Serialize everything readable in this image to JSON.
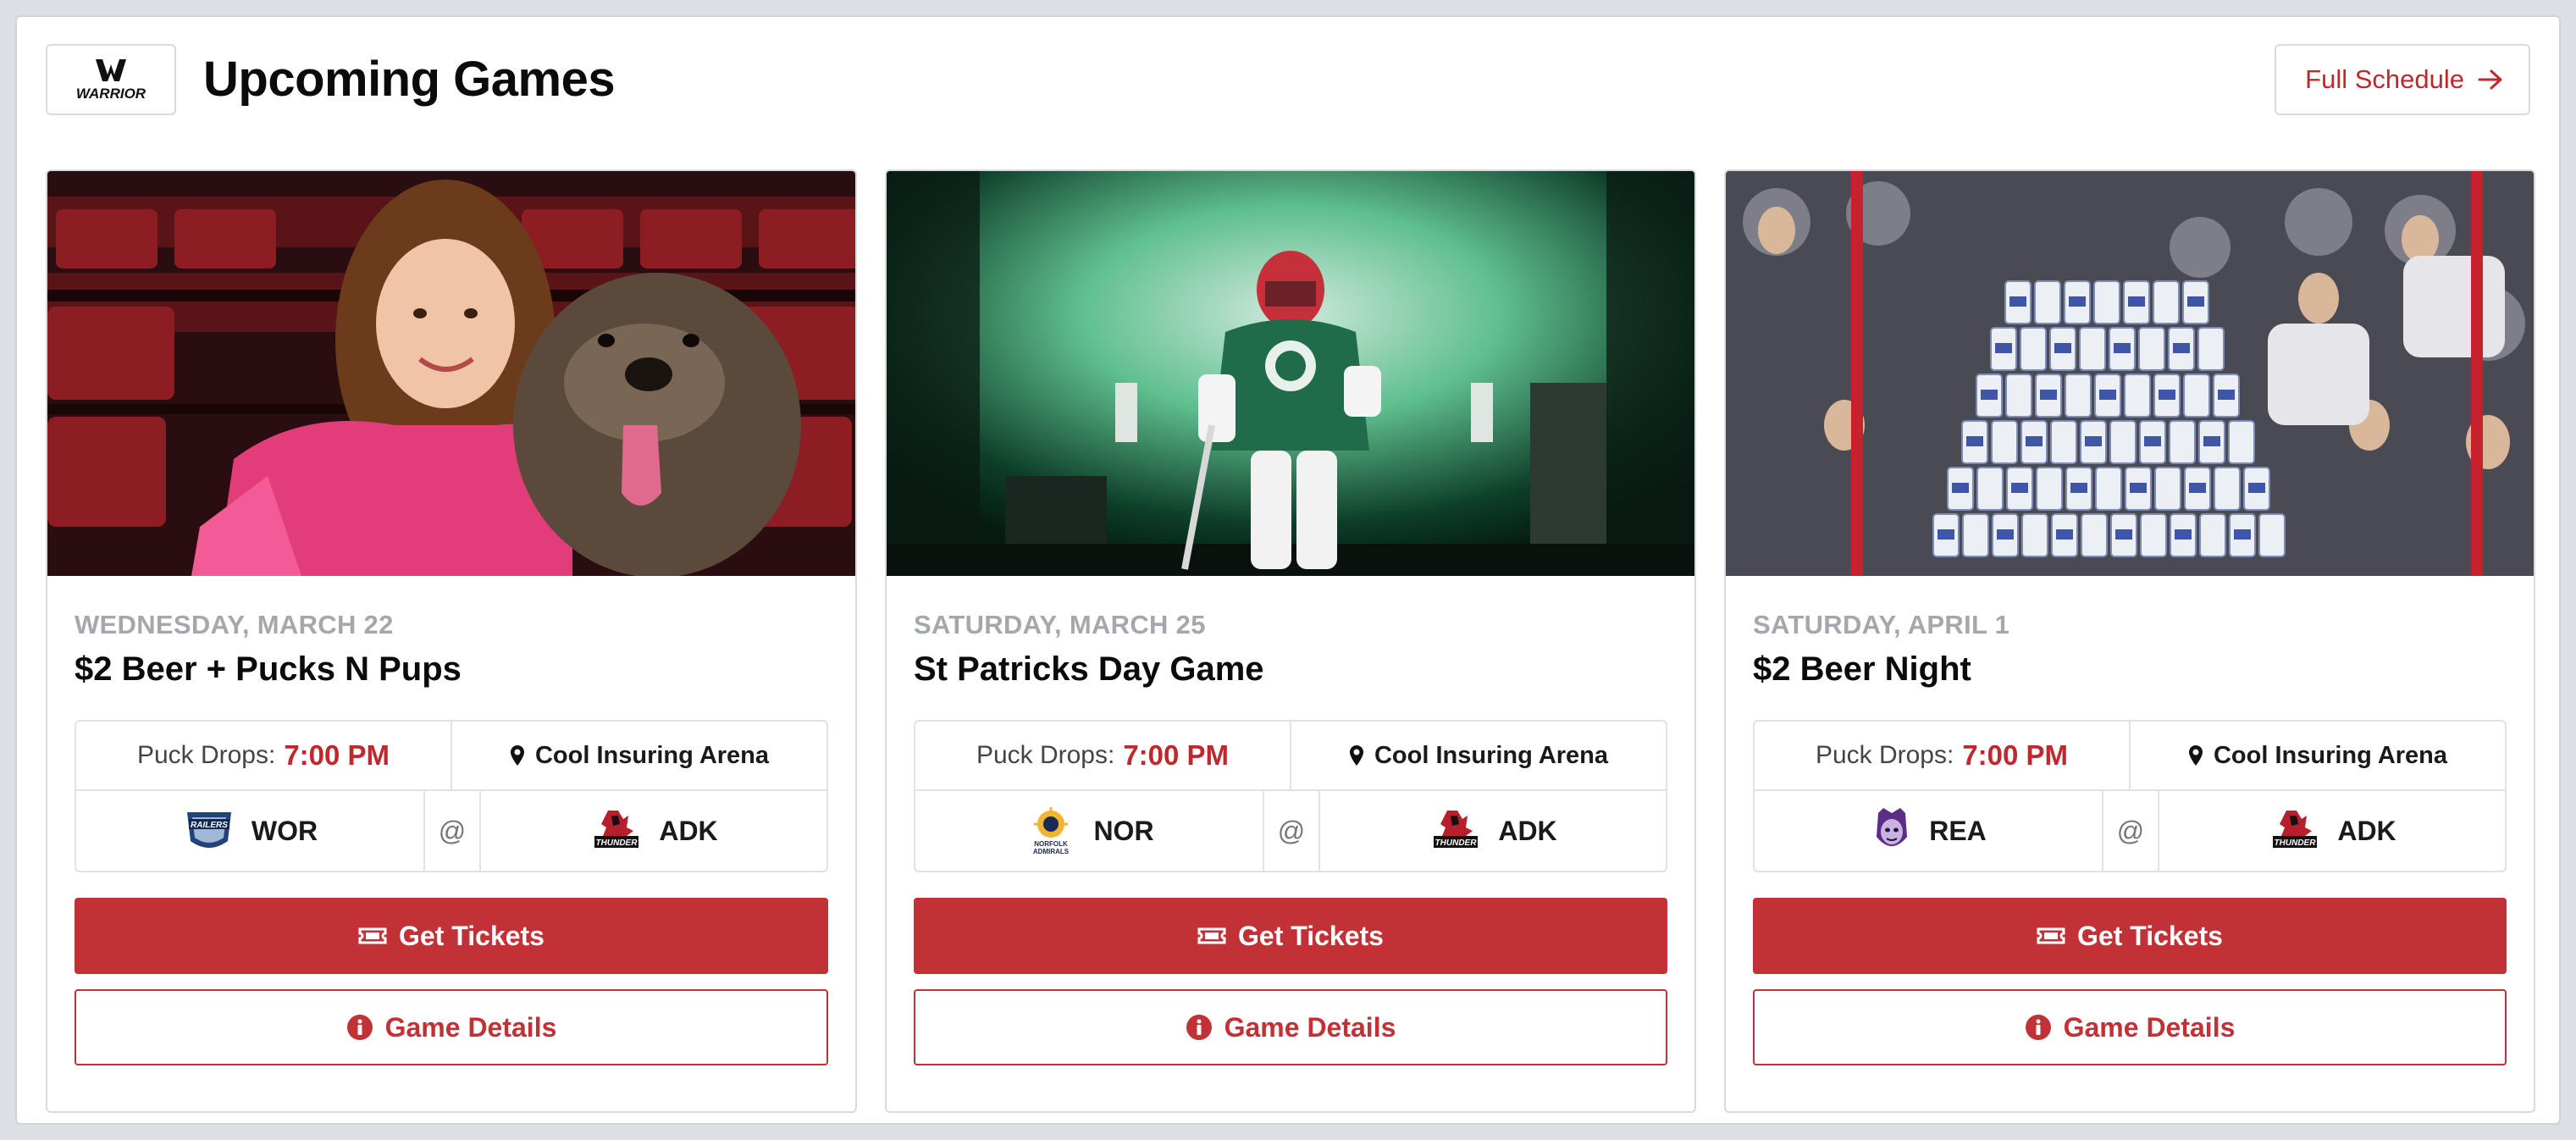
{
  "header": {
    "title": "Upcoming Games",
    "logo_text": "WARRIOR",
    "full_schedule_label": "Full Schedule"
  },
  "colors": {
    "accent": "#c23136",
    "muted": "#a4a8ad"
  },
  "cards": [
    {
      "image_icon": "photo-girl-with-dog",
      "date": "WEDNESDAY, MARCH 22",
      "title": "$2 Beer + Pucks N Pups",
      "puck_label": "Puck Drops:",
      "time": "7:00 PM",
      "arena": "Cool Insuring Arena",
      "home_team": "WOR",
      "home_logo": "railers-logo",
      "at": "@",
      "away_team": "ADK",
      "away_logo": "thunder-logo",
      "tickets_label": "Get Tickets",
      "details_label": "Game Details"
    },
    {
      "image_icon": "photo-goalie-green-smoke",
      "date": "SATURDAY, MARCH 25",
      "title": "St Patricks Day Game",
      "puck_label": "Puck Drops:",
      "time": "7:00 PM",
      "arena": "Cool Insuring Arena",
      "home_team": "NOR",
      "home_logo": "admirals-logo",
      "at": "@",
      "away_team": "ADK",
      "away_logo": "thunder-logo",
      "tickets_label": "Get Tickets",
      "details_label": "Game Details"
    },
    {
      "image_icon": "photo-beer-can-pyramid",
      "date": "SATURDAY, APRIL 1",
      "title": "$2 Beer Night",
      "puck_label": "Puck Drops:",
      "time": "7:00 PM",
      "arena": "Cool Insuring Arena",
      "home_team": "REA",
      "home_logo": "royals-logo",
      "at": "@",
      "away_team": "ADK",
      "away_logo": "thunder-logo",
      "tickets_label": "Get Tickets",
      "details_label": "Game Details"
    }
  ]
}
